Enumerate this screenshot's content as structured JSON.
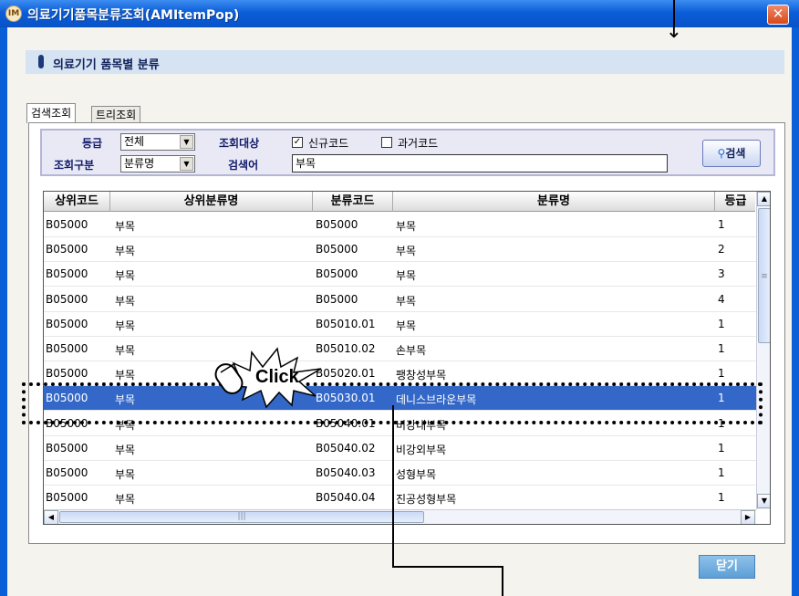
{
  "window": {
    "title": "의료기기품목분류조회(AMItemPop)",
    "close_glyph": "✕",
    "icon_text": "IM"
  },
  "header": {
    "title": "의료기기 품목별 분류"
  },
  "tabs": [
    {
      "label": "검색조회",
      "active": true
    },
    {
      "label": "트리조회",
      "active": false
    }
  ],
  "search": {
    "grade_label": "등급",
    "grade_value": "전체",
    "target_label": "조회대상",
    "new_code_label": "신규코드",
    "new_code_checked": true,
    "old_code_label": "과거코드",
    "old_code_checked": false,
    "type_label": "조회구분",
    "type_value": "분류명",
    "keyword_label": "검색어",
    "keyword_value": "부목",
    "search_button": "검색"
  },
  "grid": {
    "columns": [
      "상위코드",
      "상위분류명",
      "분류코드",
      "분류명",
      "등급"
    ],
    "rows": [
      [
        "B05000",
        "부목",
        "B05000",
        "부목",
        "1"
      ],
      [
        "B05000",
        "부목",
        "B05000",
        "부목",
        "2"
      ],
      [
        "B05000",
        "부목",
        "B05000",
        "부목",
        "3"
      ],
      [
        "B05000",
        "부목",
        "B05000",
        "부목",
        "4"
      ],
      [
        "B05000",
        "부목",
        "B05010.01",
        "부목",
        "1"
      ],
      [
        "B05000",
        "부목",
        "B05010.02",
        "손부목",
        "1"
      ],
      [
        "B05000",
        "부목",
        "B05020.01",
        "팽창성부목",
        "1"
      ],
      [
        "B05000",
        "부목",
        "B05030.01",
        "데니스브라운부목",
        "1"
      ],
      [
        "B05000",
        "부목",
        "B05040.01",
        "비강내부목",
        "1"
      ],
      [
        "B05000",
        "부목",
        "B05040.02",
        "비강외부목",
        "1"
      ],
      [
        "B05000",
        "부목",
        "B05040.03",
        "성형부목",
        "1"
      ],
      [
        "B05000",
        "부목",
        "B05040.04",
        "진공성형부목",
        "1"
      ]
    ],
    "selected_row": 7
  },
  "footer": {
    "close_button": "닫기"
  },
  "annotation": {
    "click_text": "Click"
  },
  "colors": {
    "selection": "#3468c8",
    "titlebar": "#0b5ed8",
    "close": "#d84818"
  }
}
